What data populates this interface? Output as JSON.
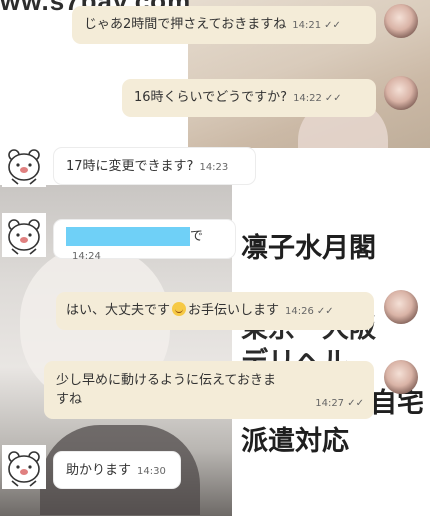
{
  "watermark": "ww.s7bav.com",
  "overlay": {
    "line1": "凛子水月閣",
    "line2": "東京・大阪",
    "line3": "デリヘル",
    "line4": "自宅",
    "line5": "派遣対応"
  },
  "messages": [
    {
      "text": "じゃあ2時間で押さえておきますね",
      "time": "14:21",
      "ticks": "✓✓"
    },
    {
      "text": "16時くらいでどうですか?",
      "time": "14:22",
      "ticks": "✓✓"
    },
    {
      "text": "17時に変更できます?",
      "time": "14:23"
    },
    {
      "text": "で",
      "time": "14:24"
    },
    {
      "text_before": "はい、大丈夫です",
      "text_after": "お手伝いします",
      "time": "14:26",
      "ticks": "✓✓"
    },
    {
      "text_line1": "少し早めに動けるように伝えておきま",
      "text_line2": "すね",
      "time": "14:27",
      "ticks": "✓✓"
    },
    {
      "text": "助かります",
      "time": "14:30"
    }
  ]
}
